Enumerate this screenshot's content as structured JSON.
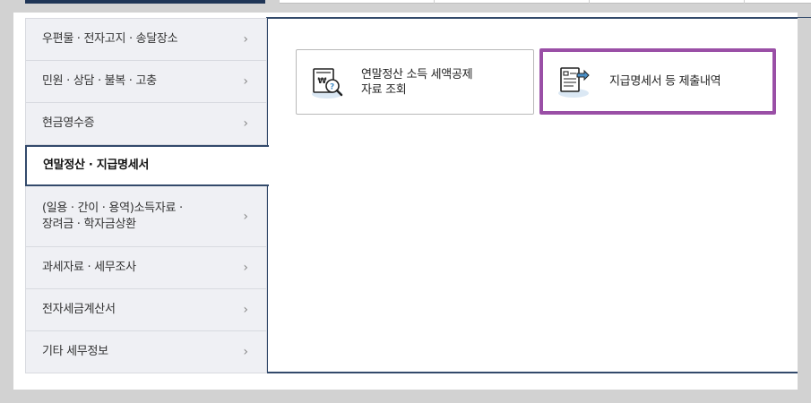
{
  "sidebar": {
    "items": [
      {
        "label": "우편물 · 전자고지 · 송달장소",
        "chevron": "›"
      },
      {
        "label": "민원 · 상담 · 불복 · 고충",
        "chevron": "›"
      },
      {
        "label": "현금영수증",
        "chevron": "›"
      },
      {
        "label": "연말정산 · 지급명세서",
        "active": true
      },
      {
        "label1": "(일용 · 간이 · 용역)소득자료 ·",
        "label2": "장려금 · 학자금상환",
        "chevron": "›"
      },
      {
        "label": "과세자료 · 세무조사",
        "chevron": "›"
      },
      {
        "label": "전자세금계산서",
        "chevron": "›"
      },
      {
        "label": "기타 세무정보",
        "chevron": "›"
      }
    ]
  },
  "content": {
    "buttons": [
      {
        "line1": "연말정산 소득 세액공제",
        "line2": "자료 조회",
        "icon": "document-search-won-icon"
      },
      {
        "label": "지급명세서 등 제출내역",
        "icon": "document-submit-arrow-icon"
      }
    ]
  },
  "colors": {
    "nav_dark": "#1f3556",
    "active_border": "#334a6b",
    "highlight": "#9a4fa6",
    "icon_accent": "#4a90c8",
    "sidebar_bg": "#eff0f4"
  }
}
